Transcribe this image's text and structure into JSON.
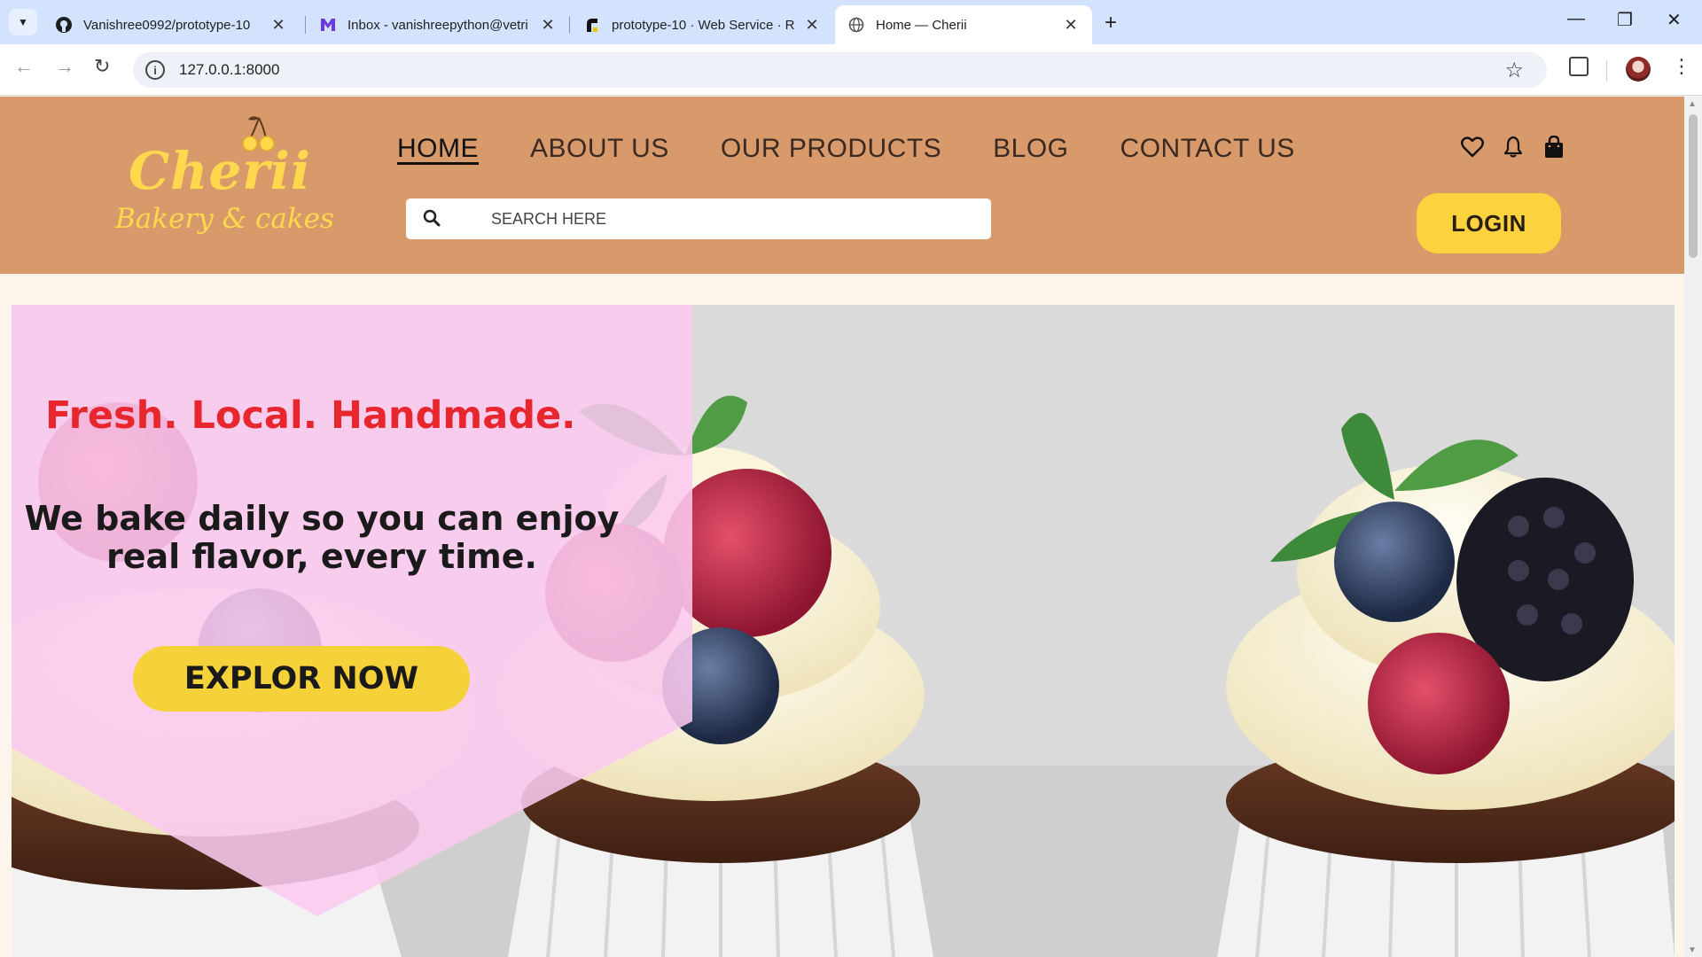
{
  "browser": {
    "tabs": [
      {
        "title": "Vanishree0992/prototype-10",
        "icon": "github-icon"
      },
      {
        "title": "Inbox - vanishreepython@vetri",
        "icon": "mail-icon"
      },
      {
        "title": "prototype-10 · Web Service · R",
        "icon": "render-icon"
      },
      {
        "title": "Home — Cherii",
        "icon": "globe-icon",
        "active": true
      }
    ],
    "url": "127.0.0.1:8000"
  },
  "site": {
    "logo": {
      "name": "Cherii",
      "tagline": "Bakery & cakes"
    },
    "nav": [
      "HOME",
      "ABOUT US",
      "OUR PRODUCTS",
      "BLOG",
      "CONTACT US"
    ],
    "search_placeholder": "SEARCH HERE",
    "login_label": "LOGIN",
    "header_icons": [
      "heart-icon",
      "bell-icon",
      "shopping-bag-icon"
    ]
  },
  "hero": {
    "tagline": "Fresh. Local. Handmade.",
    "line1": "We bake daily so you can enjoy",
    "line2": "real flavor, every time.",
    "cta": "EXPLOR NOW"
  },
  "colors": {
    "header_bg": "#d89a6b",
    "accent_yellow": "#fcd23f",
    "tagline_red": "#e8262d",
    "hero_panel_pink": "#f8c8ee",
    "page_bg": "#fdf5ec"
  }
}
